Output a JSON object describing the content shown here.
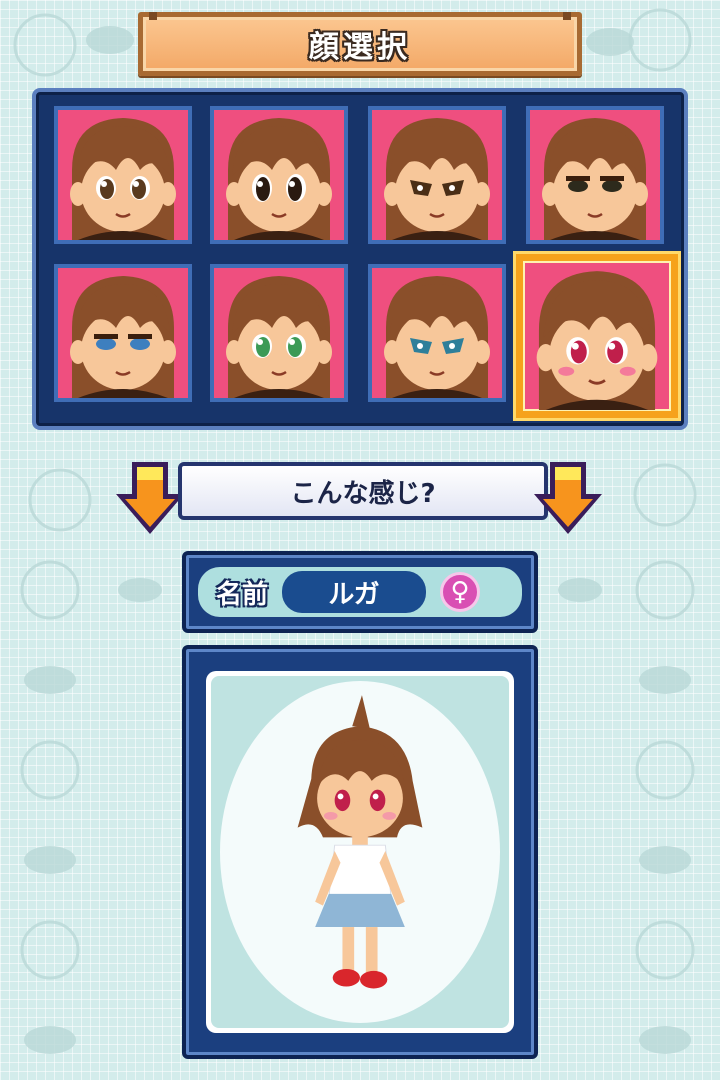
{
  "header": {
    "title": "顔選択"
  },
  "face_grid": {
    "rows": 2,
    "columns": 4,
    "selected_index": 7,
    "faces": [
      {
        "eye_color": "#5a3a1e",
        "eye_style": "round"
      },
      {
        "eye_color": "#2a1a10",
        "eye_style": "wide"
      },
      {
        "eye_color": "#4a2e16",
        "eye_style": "sharp"
      },
      {
        "eye_color": "#2d2a1c",
        "eye_style": "narrow"
      },
      {
        "eye_color": "#3d7fbf",
        "eye_style": "sleepy"
      },
      {
        "eye_color": "#3c9a56",
        "eye_style": "round"
      },
      {
        "eye_color": "#2e7f9a",
        "eye_style": "sharp"
      },
      {
        "eye_color": "#c01f4b",
        "eye_style": "round"
      }
    ]
  },
  "prompt": {
    "text": "こんな感じ?"
  },
  "profile": {
    "name_label": "名前",
    "name_value": "ルガ",
    "gender_symbol": "♀",
    "gender_color": "#d94fb3"
  },
  "colors": {
    "tile_bg": "#ef4f7f",
    "panel_bg": "#17346a",
    "selection": "#f6a21b",
    "arrow": "#f7941d",
    "hair": "#8a4f2a",
    "skin": "#f7c79a"
  }
}
